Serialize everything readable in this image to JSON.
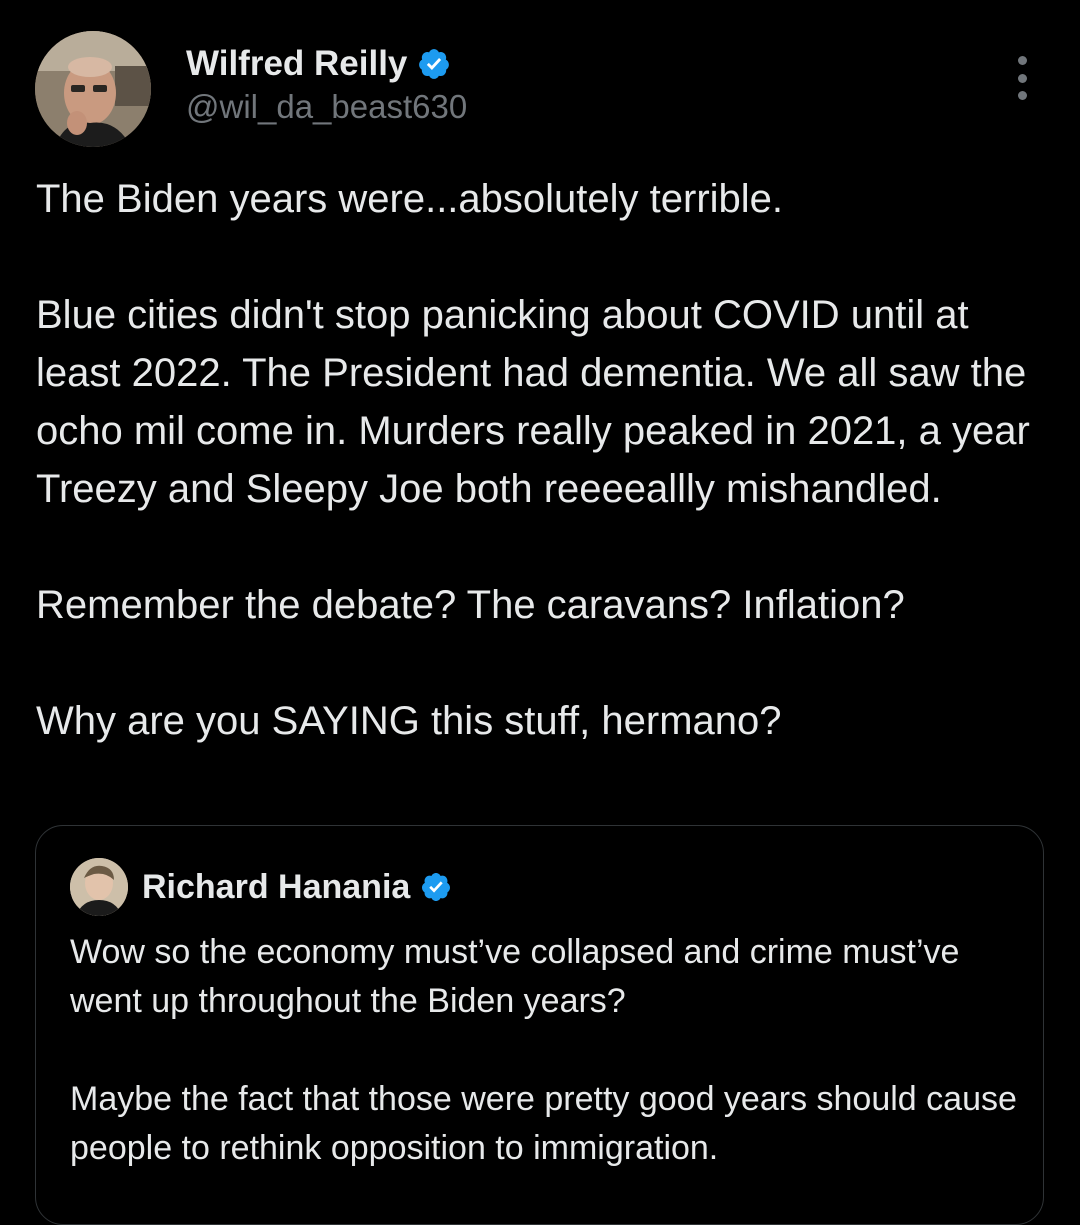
{
  "author": {
    "display_name": "Wilfred Reilly",
    "handle": "@wil_da_beast630",
    "verified_icon": "verified-badge-icon",
    "accent": "#1d9bf0"
  },
  "tweet": {
    "paragraphs": [
      "The Biden years were...absolutely terrible.",
      "Blue cities didn't stop panicking about COVID until at least 2022. The President had dementia. We all saw the ocho mil come in. Murders really peaked in 2021, a year Treezy and Sleepy Joe both reeeeallly mishandled.",
      "Remember the debate? The caravans? Inflation?",
      "Why are you SAYING this stuff, hermano?"
    ]
  },
  "quoted": {
    "display_name": "Richard Hanania",
    "verified_icon": "verified-badge-icon",
    "paragraphs": [
      "Wow so the economy must’ve collapsed and crime must’ve went up throughout the Biden years?",
      "Maybe the fact that those were pretty good years should cause people to rethink opposition to immigration."
    ]
  },
  "colors": {
    "background": "#000000",
    "text_primary": "#e7e9ea",
    "text_secondary": "#71767b",
    "border": "#2f3336"
  }
}
